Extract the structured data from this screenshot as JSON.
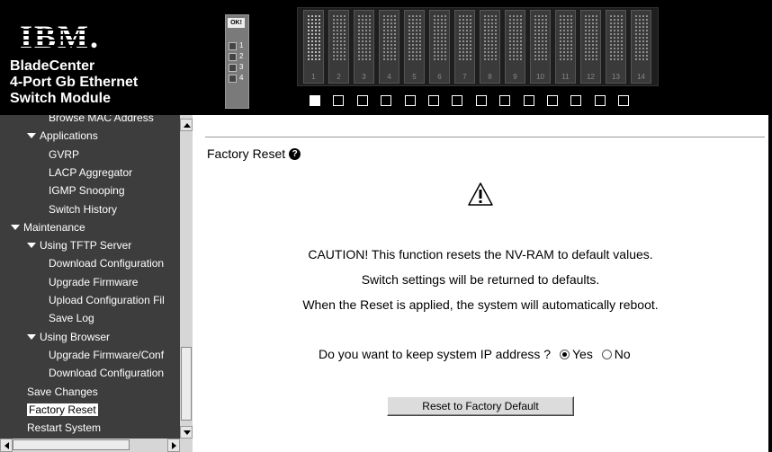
{
  "brand": {
    "logo_text": "IBM.",
    "product_line1": "BladeCenter",
    "product_line2": "4-Port Gb Ethernet",
    "product_line3": "Switch Module"
  },
  "module_panel": {
    "ok_label": "OK!",
    "ports": [
      "1",
      "2",
      "3",
      "4"
    ]
  },
  "chassis": {
    "bays": [
      "1",
      "2",
      "3",
      "4",
      "5",
      "6",
      "7",
      "8",
      "9",
      "10",
      "11",
      "12",
      "13",
      "14"
    ],
    "selected_bay": "1"
  },
  "sidebar": {
    "items": [
      {
        "label": "Browse MAC Address",
        "level": 3
      },
      {
        "label": "Applications",
        "level": 2,
        "expanded": true
      },
      {
        "label": "GVRP",
        "level": 3
      },
      {
        "label": "LACP Aggregator",
        "level": 3
      },
      {
        "label": "IGMP Snooping",
        "level": 3
      },
      {
        "label": "Switch History",
        "level": 3
      },
      {
        "label": "Maintenance",
        "level": 1,
        "expanded": true
      },
      {
        "label": "Using TFTP Server",
        "level": 2,
        "expanded": true
      },
      {
        "label": "Download Configuration",
        "level": 3
      },
      {
        "label": "Upgrade Firmware",
        "level": 3
      },
      {
        "label": "Upload Configuration Fil",
        "level": 3
      },
      {
        "label": "Save Log",
        "level": 3
      },
      {
        "label": "Using Browser",
        "level": 2,
        "expanded": true
      },
      {
        "label": "Upgrade Firmware/Conf",
        "level": 3
      },
      {
        "label": "Download Configuration",
        "level": 3
      },
      {
        "label": "Save Changes",
        "level": 2
      },
      {
        "label": "Factory Reset",
        "level": 2,
        "selected": true
      },
      {
        "label": "Restart System",
        "level": 2
      }
    ]
  },
  "main": {
    "title": "Factory Reset",
    "help_icon": "?",
    "caution_line1": "CAUTION! This function resets the NV-RAM to default values.",
    "caution_line2": "Switch settings will be returned to defaults.",
    "caution_line3": "When the Reset is applied, the system will automatically reboot.",
    "question": "Do you want to keep system IP address ?",
    "option_yes": "Yes",
    "option_no": "No",
    "selected_option": "Yes",
    "reset_button": "Reset to Factory Default"
  },
  "colors": {
    "header_bg": "#000000",
    "sidebar_bg": "#3d3d3d",
    "content_bg": "#ffffff"
  },
  "icons": {
    "warning": "warning-triangle-icon",
    "help": "help-circle-icon"
  }
}
